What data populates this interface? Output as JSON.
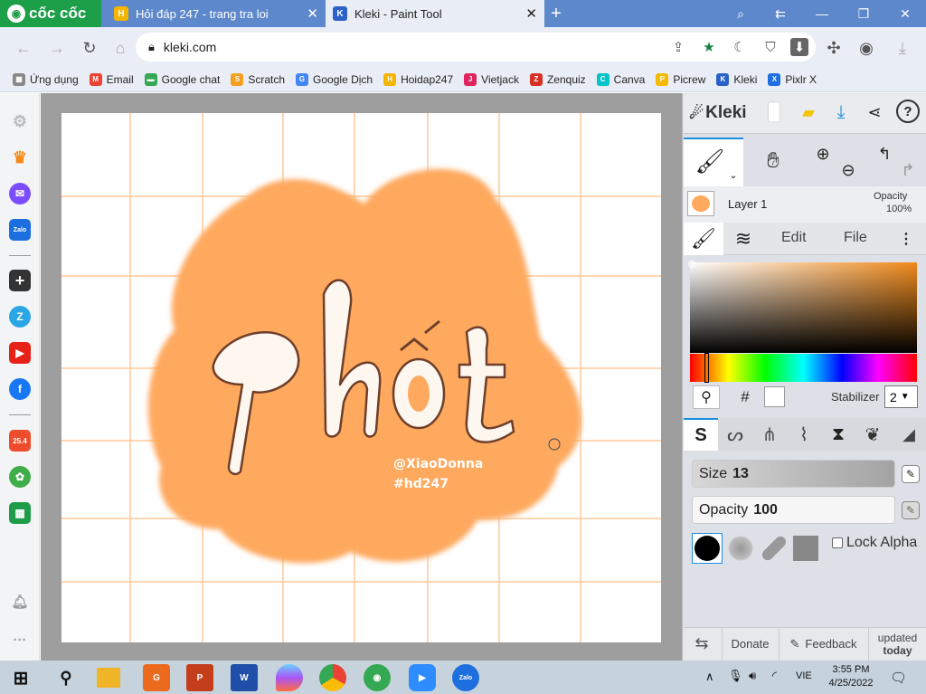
{
  "browser": {
    "brand": "cốc cốc",
    "tabs": [
      {
        "title": "Hỏi đáp 247 - trang tra loi",
        "active": false
      },
      {
        "title": "Kleki - Paint Tool",
        "active": true
      }
    ],
    "url": "kleki.com",
    "bookmarks": [
      {
        "label": "Ứng dụng",
        "icon": "apps-grid-icon"
      },
      {
        "label": "Email",
        "icon": "gmail-icon"
      },
      {
        "label": "Google chat",
        "icon": "google-chat-icon"
      },
      {
        "label": "Scratch",
        "icon": "scratch-icon"
      },
      {
        "label": "Google Dịch",
        "icon": "google-translate-icon"
      },
      {
        "label": "Hoidap247",
        "icon": "hoidap247-icon"
      },
      {
        "label": "Vietjack",
        "icon": "vietjack-icon"
      },
      {
        "label": "Zenquiz",
        "icon": "zenquiz-icon"
      },
      {
        "label": "Canva",
        "icon": "canva-icon"
      },
      {
        "label": "Picrew",
        "icon": "picrew-icon"
      },
      {
        "label": "Kleki",
        "icon": "kleki-icon"
      },
      {
        "label": "Pixlr X",
        "icon": "pixlr-icon"
      }
    ]
  },
  "artwork": {
    "title": "Phốt",
    "handle": "@XiaoDonna",
    "tag": "#hd247",
    "blob_color": "#ffa95e",
    "grid_color": "#ffc999"
  },
  "kleki": {
    "brand": "Kleki",
    "layer": {
      "name": "Layer 1",
      "opacity_label": "Opacity",
      "opacity_value": "100%"
    },
    "tabs": [
      "Edit",
      "File"
    ],
    "hex_label": "#",
    "stabilizer_label": "Stabilizer",
    "stabilizer_value": "2",
    "size_label": "Size",
    "size_value": "13",
    "opacity_label": "Opacity",
    "opacity_value": "100",
    "lock_alpha_label": "Lock Alpha",
    "footer": {
      "donate": "Donate",
      "feedback": "Feedback",
      "updated": "updated",
      "today": "today"
    },
    "current_color": "#f08a1c"
  },
  "taskbar": {
    "language": "VIE",
    "time": "3:55 PM",
    "date": "4/25/2022"
  }
}
